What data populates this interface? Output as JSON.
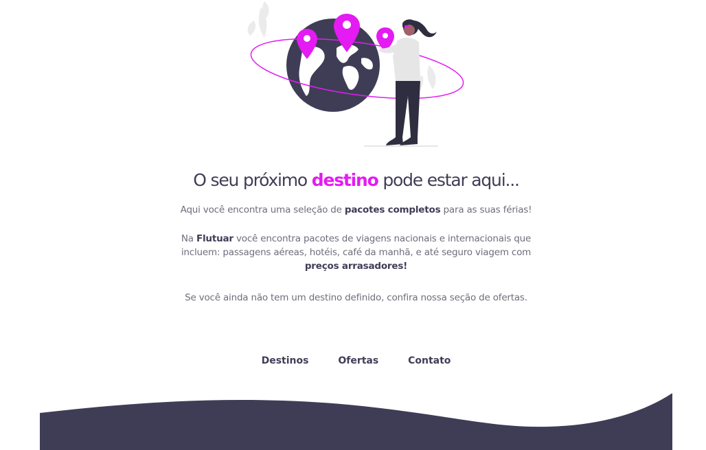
{
  "headline": {
    "before": "O seu próximo ",
    "accent": "destino",
    "after": " pode estar aqui..."
  },
  "intro": {
    "line1_before": "Aqui você encontra uma seleção de ",
    "line1_bold": "pacotes completos",
    "line1_after": " para as suas férias!",
    "para2_before": "Na ",
    "para2_bold1": "Flutuar",
    "para2_mid": " você encontra pacotes de viagens nacionais e internacionais que",
    "para2_line2": "incluem: passagens aéreas, hotéis, café da manhã, e até seguro viagem com",
    "para2_bold2": "preços arrasadores!",
    "para3": "Se você ainda não tem um destino definido, confira nossa seção de ofertas."
  },
  "nav": {
    "items": [
      "Destinos",
      "Ofertas",
      "Contato"
    ]
  },
  "colors": {
    "accent": "#e41bf2",
    "dark": "#3f3d56",
    "text": "#6f6d7a"
  },
  "icons": {
    "hero": "woman-with-globe-and-map-pins-illustration"
  }
}
